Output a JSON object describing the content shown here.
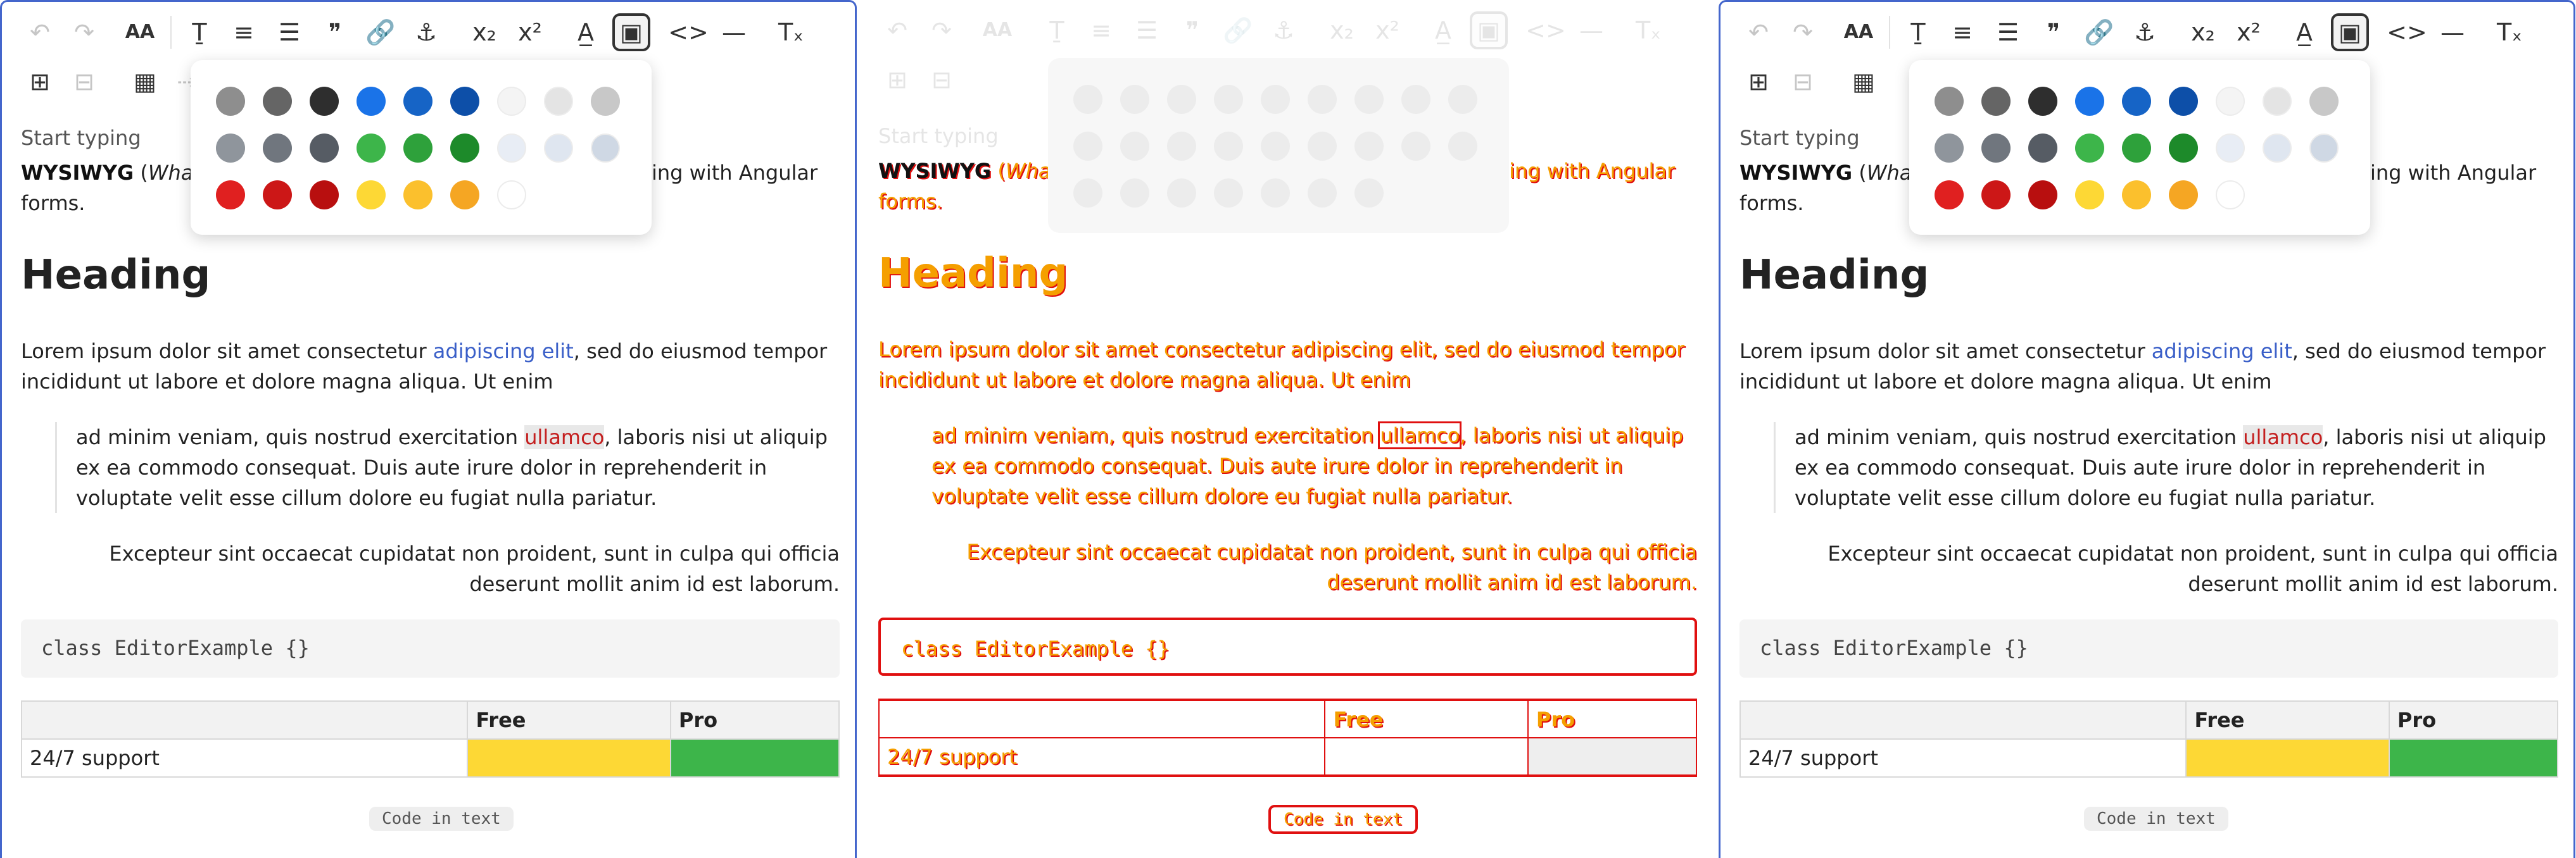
{
  "toolbar": {
    "row1": [
      "undo-icon",
      "redo-icon",
      "font-size-icon",
      "text-style-icon",
      "align-icon",
      "bullet-list-icon",
      "quote-icon",
      "link-icon",
      "anchor-icon",
      "subscript-icon",
      "superscript-icon",
      "text-color-icon",
      "highlight-icon",
      "code-icon",
      "horizontal-rule-icon",
      "clear-format-icon"
    ],
    "row2": [
      "insert-block-icon",
      "remove-block-icon",
      "table-icon",
      "more-icon"
    ]
  },
  "editor": {
    "placeholder": "Start typing",
    "intro_bold": "WYSIWYG",
    "intro_paren": "(",
    "intro_italic": "What",
    "intro_tail": "ing with Angular",
    "intro_line2": "forms.",
    "heading": "Heading",
    "para_1": "Lorem ipsum dolor sit amet consectetur ",
    "para_link": "adipiscing elit",
    "para_2": ", sed do eiusmod tempor incididunt ut labore et dolore magna aliqua. Ut enim",
    "quote_1": "ad minim veniam, quis nostrud exercitation ",
    "quote_highlight": "ullamco",
    "quote_2": ", laboris nisi ut aliquip ex ea commodo consequat. Duis aute irure dolor in reprehenderit in voluptate velit esse cillum dolore eu fugiat nulla pariatur.",
    "right_text": "Excepteur sint occaecat cupidatat non proident, sunt in culpa qui officia deserunt mollit anim id est laborum.",
    "code_block": "class EditorExample {}",
    "table": {
      "headers": [
        "",
        "Free",
        "Pro"
      ],
      "row": [
        "24/7 support",
        "",
        ""
      ]
    },
    "inline_code": "Code in text"
  },
  "palette": {
    "row1": [
      "#8e8e8e",
      "#656565",
      "#2e2e2e",
      "#1a73e8",
      "#1664c6",
      "#0d4fa8",
      "#f4f4f4",
      "#e4e4e4",
      "#c8c8c8"
    ],
    "row2": [
      "#8f959c",
      "#70767e",
      "#565c64",
      "#3db54a",
      "#2ea13b",
      "#1d8a2a",
      "#e8edf5",
      "#dfe6f0",
      "#cfd8e4"
    ],
    "row3": [
      "#e02020",
      "#cc1717",
      "#b80f0f",
      "#fdd835",
      "#fbc02d",
      "#f5a623",
      "#ffffff"
    ]
  },
  "colors": {
    "accent": "#4466cc",
    "link": "#3a5fc8",
    "diff_text": "#f59f00",
    "diff_outline": "#e01010"
  }
}
